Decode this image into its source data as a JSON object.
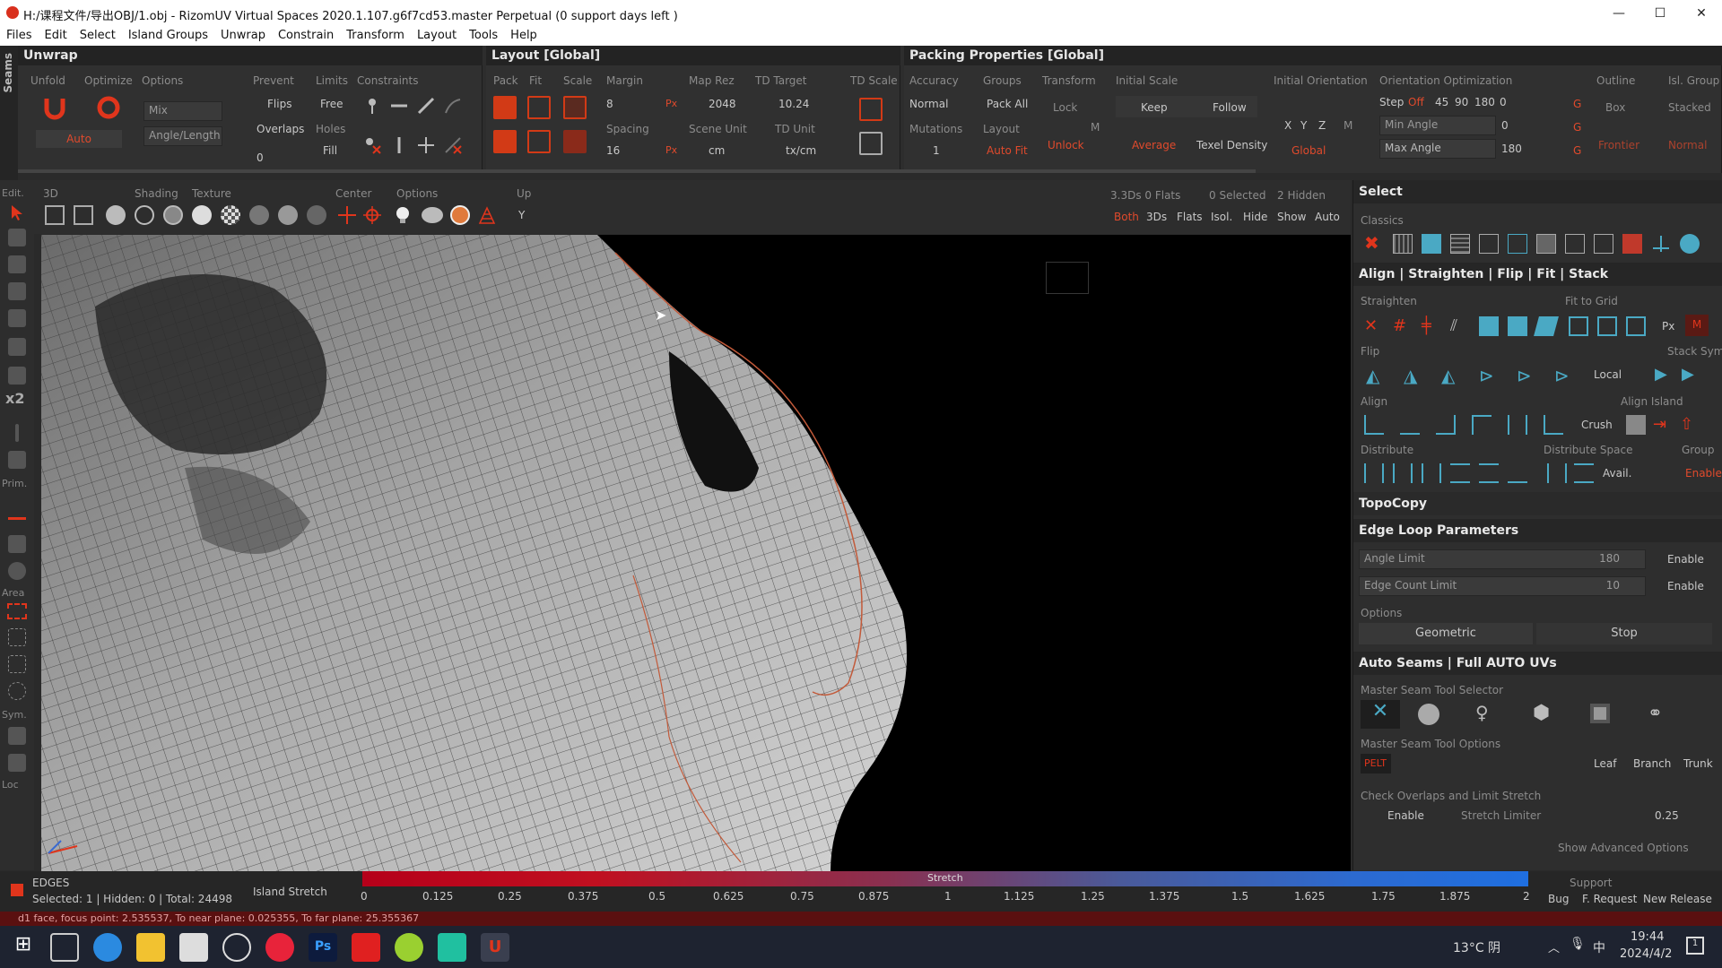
{
  "window": {
    "title": "H:/课程文件/导出OBJ/1.obj - RizomUV  Virtual Spaces 2020.1.107.g6f7cd53.master Perpetual  (0 support days left )",
    "minimize": "—",
    "maximize": "☐",
    "close": "✕"
  },
  "menu": [
    "Files",
    "Edit",
    "Select",
    "Island Groups",
    "Unwrap",
    "Constrain",
    "Transform",
    "Layout",
    "Tools",
    "Help"
  ],
  "seams_tab": "Seams",
  "unwrap": {
    "title": "Unwrap",
    "unfold": "Unfold",
    "optimize": "Optimize",
    "options": "Options",
    "prevent": "Prevent",
    "limits": "Limits",
    "constraints": "Constraints",
    "mix": "Mix",
    "angle_length": "Angle/Length",
    "auto": "Auto",
    "flips": "Flips",
    "overlaps": "Overlaps",
    "free": "Free",
    "holes": "Holes",
    "fill": "Fill",
    "zero": "0"
  },
  "layout": {
    "title": "Layout [Global]",
    "pack": "Pack",
    "fit": "Fit",
    "scale": "Scale",
    "margin": "Margin",
    "margin_val": "8",
    "spacing": "Spacing",
    "spacing_val": "16",
    "map_rez": "Map Rez",
    "map_rez_val": "2048",
    "scene_unit": "Scene Unit",
    "scene_unit_val": "cm",
    "td_target": "TD Target",
    "td_target_val": "10.24",
    "td_unit": "TD Unit",
    "td_unit_val": "tx/cm",
    "td_scale": "TD Scale",
    "px": "Px"
  },
  "packing": {
    "title": "Packing Properties [Global]",
    "accuracy": "Accuracy",
    "accuracy_val": "Normal",
    "mutations": "Mutations",
    "mutations_val": "1",
    "groups": "Groups",
    "pack_all": "Pack All",
    "layout": "Layout",
    "auto_fit": "Auto Fit",
    "transform": "Transform",
    "lock": "Lock",
    "unlock": "Unlock",
    "m": "M",
    "initial_scale": "Initial Scale",
    "keep": "Keep",
    "follow": "Follow",
    "average": "Average",
    "texel_density": "Texel Density",
    "initial_orientation": "Initial Orientation",
    "x": "X",
    "y": "Y",
    "z": "Z",
    "global": "Global",
    "orientation_opt": "Orientation Optimization",
    "step": "Step",
    "off": "Off",
    "a45": "45",
    "a90": "90",
    "a180": "180",
    "zero": "0",
    "min_angle": "Min Angle",
    "max_angle": "Max Angle",
    "max_angle_val": "180",
    "g": "G",
    "outline": "Outline",
    "box": "Box",
    "frontier": "Frontier",
    "isl_group": "Isl. Group",
    "stacked": "Stacked",
    "normal": "Normal"
  },
  "vp": {
    "edit": "Edit.",
    "d3": "3D",
    "shading": "Shading",
    "texture": "Texture",
    "center": "Center",
    "options": "Options",
    "up": "Up",
    "upval": "Y",
    "stats": "3.3Ds 0 Flats",
    "selected": "0 Selected",
    "hidden": "2 Hidden",
    "both": "Both",
    "d3s": "3Ds",
    "flats": "Flats",
    "isol": "Isol.",
    "hide": "Hide",
    "show": "Show",
    "auto": "Auto"
  },
  "leftbar": {
    "x2": "x2",
    "prim": "Prim.",
    "area": "Area",
    "sym": "Sym.",
    "loc": "Loc"
  },
  "right": {
    "select": "Select",
    "classics": "Classics",
    "align_title": "Align | Straighten | Flip | Fit | Stack",
    "straighten": "Straighten",
    "fit_to_grid": "Fit to Grid",
    "px": "Px",
    "m": "M",
    "flip": "Flip",
    "stack_sym": "Stack Sym.",
    "local": "Local",
    "align": "Align",
    "align_island": "Align Island",
    "crush": "Crush",
    "distribute": "Distribute",
    "distribute_space": "Distribute Space",
    "group": "Group",
    "avail": "Avail.",
    "enable": "Enable",
    "topocopy": "TopoCopy",
    "edge_loop": "Edge Loop Parameters",
    "angle_limit": "Angle Limit",
    "angle_limit_val": "180",
    "edge_count": "Edge Count Limit",
    "edge_count_val": "10",
    "options": "Options",
    "geometric": "Geometric",
    "stop": "Stop",
    "auto_seams": "Auto Seams | Full AUTO UVs",
    "master_sel": "Master Seam Tool Selector",
    "master_opt": "Master Seam Tool Options",
    "pelt": "PELT",
    "leaf": "Leaf",
    "branch": "Branch",
    "trunk": "Trunk",
    "check_overlaps": "Check Overlaps and Limit Stretch",
    "stretch_limiter": "Stretch Limiter",
    "stretch_val": "0.25",
    "show_adv": "Show Advanced Options",
    "q": "?"
  },
  "status": {
    "mode": "EDGES",
    "counts": "Selected: 1 | Hidden: 0 | Total: 24498",
    "island_stretch": "Island Stretch",
    "stretch": "Stretch",
    "ticks": [
      "0",
      "0.125",
      "0.25",
      "0.375",
      "0.5",
      "0.625",
      "0.75",
      "0.875",
      "1",
      "1.125",
      "1.25",
      "1.375",
      "1.5",
      "1.625",
      "1.75",
      "1.875",
      "2"
    ],
    "support": "Support",
    "bug": "Bug",
    "freq": "F. Request",
    "release": "New Release"
  },
  "infobar": "d1 face, focus point: 2.535537, To near plane: 0.025355, To far plane: 25.355367",
  "taskbar": {
    "weather": "13°C 阴",
    "ime": "中",
    "time": "19:44",
    "date": "2024/4/2",
    "notify": "1"
  }
}
